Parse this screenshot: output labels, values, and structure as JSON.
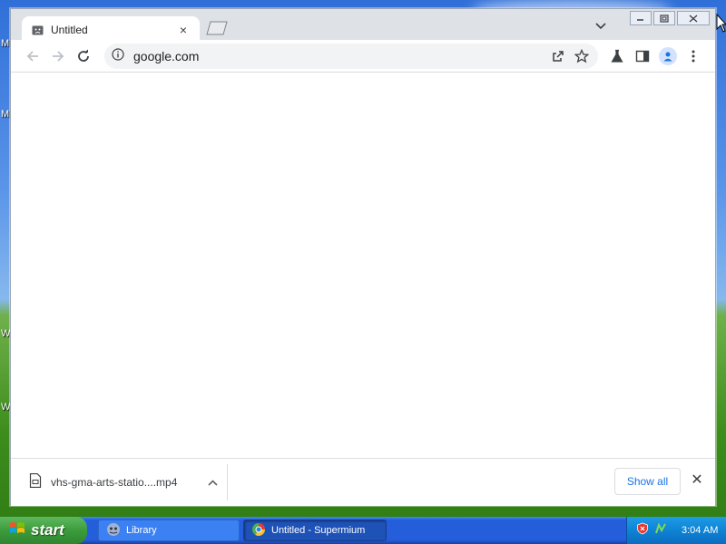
{
  "window": {
    "tab_title": "Untitled",
    "tab_close_icon": "×",
    "tab_search_icon": "⌄"
  },
  "toolbar": {
    "url": "google.com"
  },
  "downloads": {
    "filename": "vhs-gma-arts-statio....mp4",
    "chevron": "^",
    "show_all": "Show all",
    "close": "✕"
  },
  "taskbar": {
    "start_label": "start",
    "tasks": [
      {
        "label": "Library"
      },
      {
        "label": "Untitled - Supermium"
      }
    ],
    "clock": "3:04 AM"
  },
  "colors": {
    "link_blue": "#1a73e8",
    "taskbar_blue": "#245edb",
    "start_green": "#3c9c3c"
  }
}
